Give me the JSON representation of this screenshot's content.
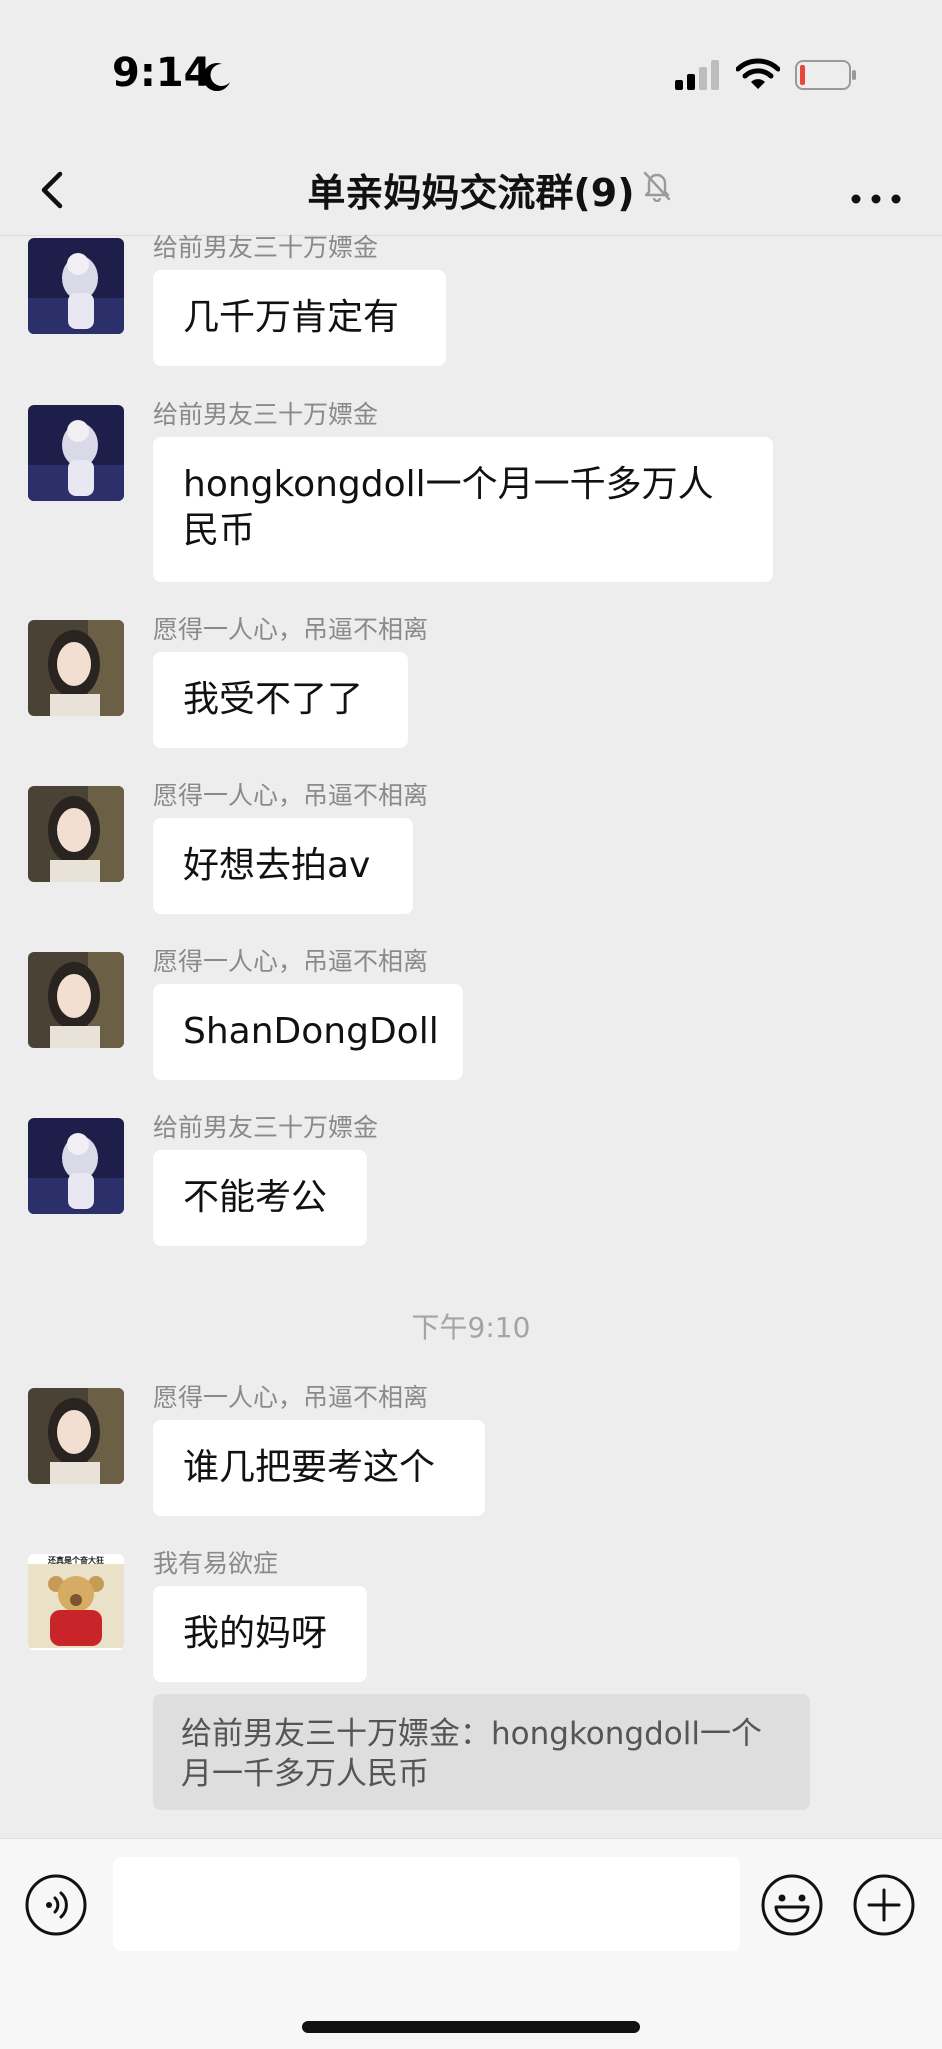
{
  "status_bar": {
    "time": "9:14",
    "battery_color": "#e8463a"
  },
  "nav": {
    "title": "单亲妈妈交流群(9)"
  },
  "messages": [
    {
      "sender": "给前男友三十万嫖金",
      "text": "几千万肯定有",
      "avatar": "anime-girl-avatar"
    },
    {
      "sender": "给前男友三十万嫖金",
      "text_line1": "hongkongdoll一个月一千多万人",
      "text_line2": "民币",
      "avatar": "anime-girl-avatar"
    },
    {
      "sender": "愿得一人心，吊逼不相离",
      "text": "我受不了了",
      "avatar": "girl-photo-avatar"
    },
    {
      "sender": "愿得一人心，吊逼不相离",
      "text": "好想去拍av",
      "avatar": "girl-photo-avatar"
    },
    {
      "sender": "愿得一人心，吊逼不相离",
      "text": "ShanDongDoll",
      "avatar": "girl-photo-avatar"
    },
    {
      "sender": "给前男友三十万嫖金",
      "text": "不能考公",
      "avatar": "anime-girl-avatar"
    },
    {
      "sender": "愿得一人心，吊逼不相离",
      "text": "谁几把要考这个",
      "avatar": "girl-photo-avatar"
    },
    {
      "sender": "我有易欲症",
      "text": "我的妈呀",
      "avatar": "teddy-bear-avatar",
      "avatar_caption": "还真是个奋大狂"
    }
  ],
  "timestamp": "下午9:10",
  "quote": {
    "line1": "给前男友三十万嫖金：hongkongdoll一个",
    "line2": "月一千多万人民币"
  },
  "input_bar": {
    "placeholder": ""
  }
}
